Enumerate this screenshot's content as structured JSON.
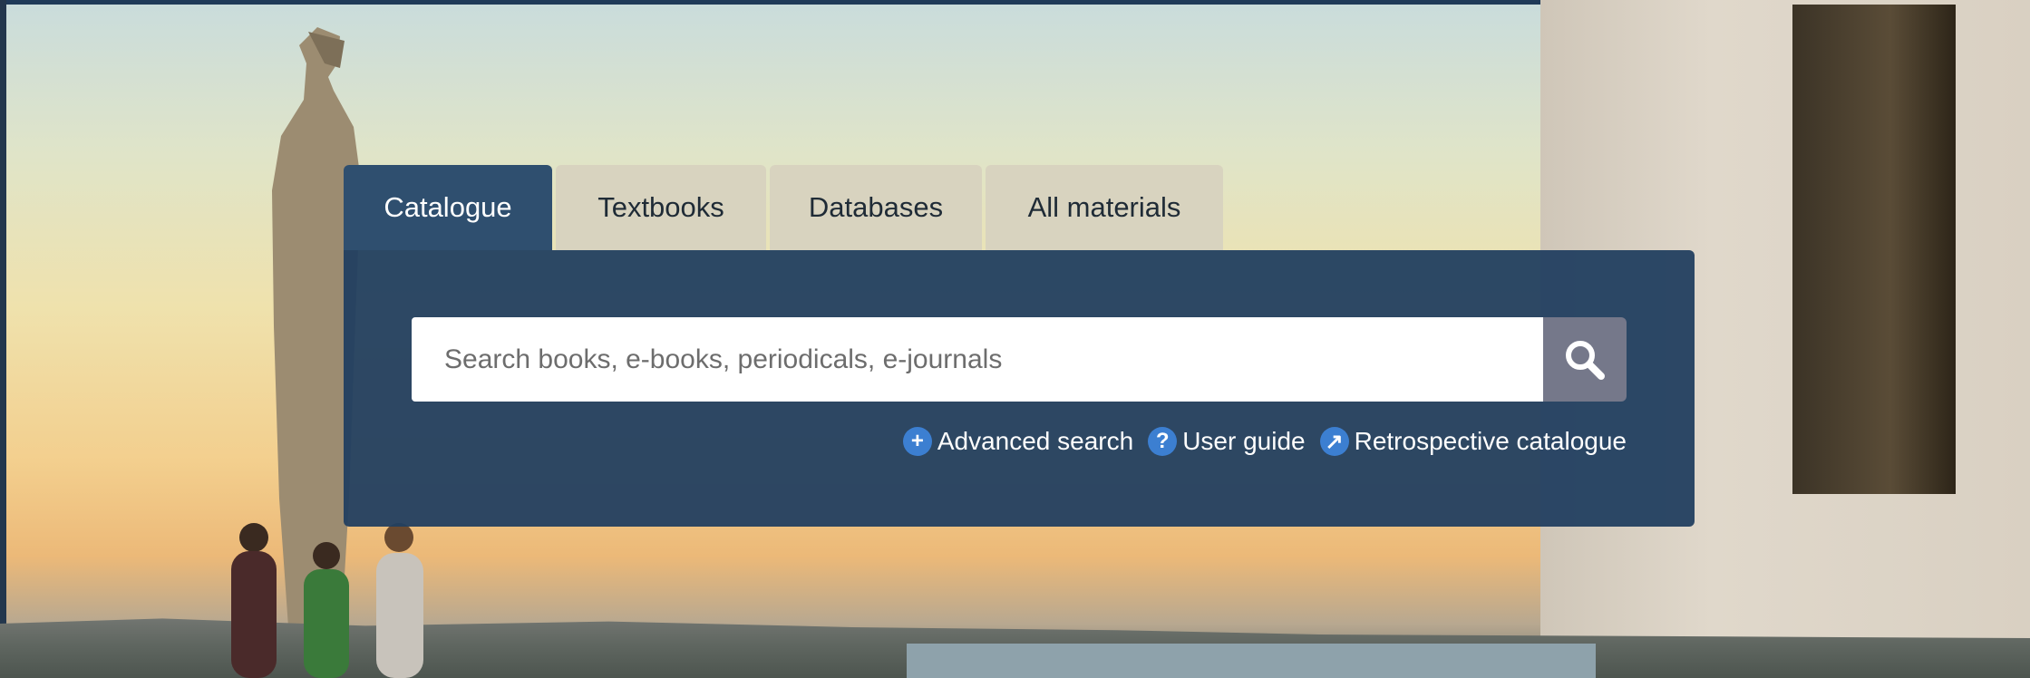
{
  "colors": {
    "panel": "#223f60",
    "active_tab": "#2f4f6f",
    "inactive_tab": "#d8d3bf",
    "search_button": "#75788a",
    "link_icon": "#3c7fd1"
  },
  "tabs": [
    {
      "label": "Catalogue",
      "active": true
    },
    {
      "label": "Textbooks",
      "active": false
    },
    {
      "label": "Databases",
      "active": false
    },
    {
      "label": "All materials",
      "active": false
    }
  ],
  "search": {
    "placeholder": "Search books, e-books, periodicals, e-journals",
    "value": "",
    "button_icon": "search-icon"
  },
  "links": [
    {
      "label": "Advanced search",
      "icon": "plus-circle-icon"
    },
    {
      "label": "User guide",
      "icon": "question-circle-icon"
    },
    {
      "label": "Retrospective catalogue",
      "icon": "external-arrow-icon"
    }
  ]
}
